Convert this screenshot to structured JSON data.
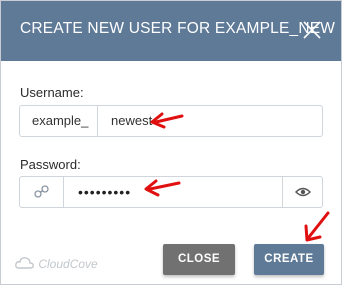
{
  "dialog": {
    "title": "CREATE NEW USER FOR EXAMPLE_NEW",
    "close_icon": "close-x-icon"
  },
  "username": {
    "label": "Username:",
    "prefix": "example_",
    "value": "newest"
  },
  "password": {
    "label": "Password:",
    "key_icon": "key-icon",
    "masked_value": "•••••••••",
    "toggle_icon": "eye-icon"
  },
  "buttons": {
    "close": "CLOSE",
    "create": "CREATE"
  },
  "logo": {
    "text": "CloudCove",
    "icon": "cloud-logo-icon"
  },
  "annotations": {
    "arrow_color": "#e01010"
  },
  "colors": {
    "header": "#5e7a97",
    "close_button": "#717171",
    "create_button": "#5e7a97"
  }
}
